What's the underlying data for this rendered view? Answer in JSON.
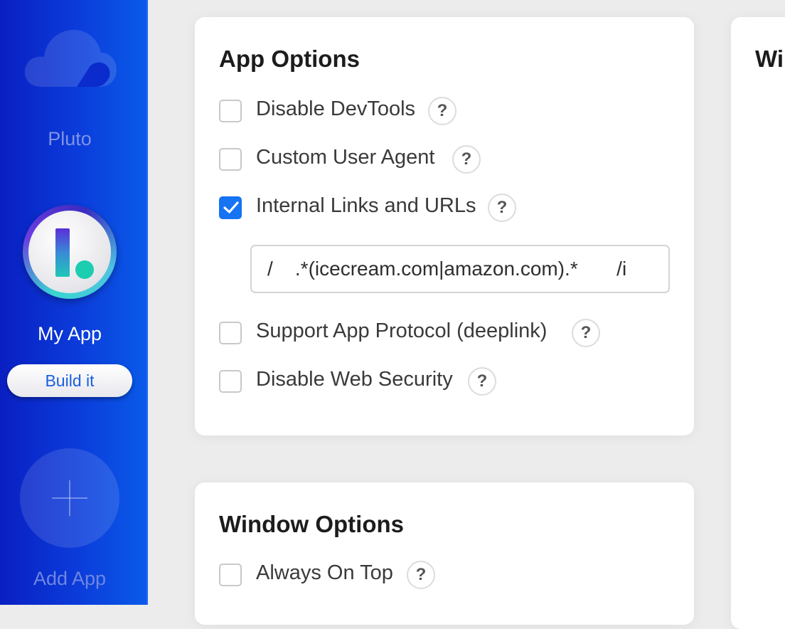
{
  "sidebar": {
    "apps": [
      {
        "label": "Pluto",
        "icon": "cloud-icon"
      },
      {
        "label": "My App",
        "icon": "app-logo-icon",
        "build_label": "Build it"
      }
    ],
    "add_app": {
      "label": "Add App",
      "icon": "plus-icon"
    }
  },
  "app_options": {
    "title": "App Options",
    "options": [
      {
        "label": "Disable DevTools",
        "checked": false,
        "help": "?"
      },
      {
        "label": "Custom User Agent",
        "checked": false,
        "help": "?"
      },
      {
        "label": "Internal Links and URLs",
        "checked": true,
        "help": "?"
      },
      {
        "label": "Support App Protocol (deeplink)",
        "checked": false,
        "help": "?"
      },
      {
        "label": "Disable Web Security",
        "checked": false,
        "help": "?"
      }
    ],
    "internal_links_value": "/    .*(icecream.com|amazon.com).*       /i"
  },
  "window_options": {
    "title": "Window Options",
    "options": [
      {
        "label": "Always On Top",
        "checked": false,
        "help": "?"
      }
    ]
  },
  "right_panel": {
    "title_partial": "Wi"
  },
  "colors": {
    "sidebar_from": "#0a1fc2",
    "sidebar_to": "#0a5ae8",
    "checkbox_checked": "#1673f2",
    "build_button_text": "#1a5fe0"
  }
}
